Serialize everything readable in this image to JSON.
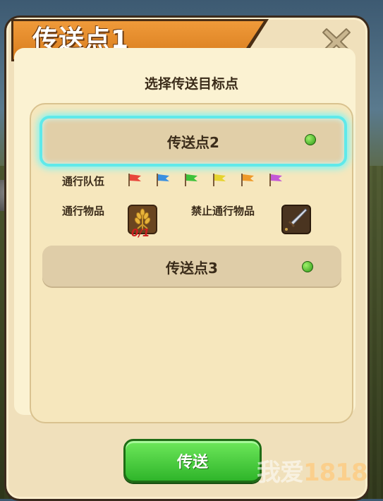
{
  "dialog": {
    "title": "传送点1",
    "subtitle": "选择传送目标点",
    "close_icon": "close-x-icon"
  },
  "destinations": [
    {
      "name": "传送点2",
      "selected": true,
      "status_color": "#3fbf1e"
    },
    {
      "name": "传送点3",
      "selected": false,
      "status_color": "#3fbf1e"
    }
  ],
  "details": {
    "teams_label": "通行队伍",
    "team_flags": [
      "#e8463a",
      "#3a8fe0",
      "#3ec23a",
      "#e6d32e",
      "#ef9a2a",
      "#c45ad6"
    ],
    "items_label": "通行物品",
    "item_icon": "wheat-icon",
    "item_count": "0/1",
    "forbidden_label": "禁止通行物品",
    "forbidden_icon": "sword-icon"
  },
  "actions": {
    "send_label": "传送"
  },
  "watermark": {
    "text": "我爱",
    "number": "1818"
  }
}
